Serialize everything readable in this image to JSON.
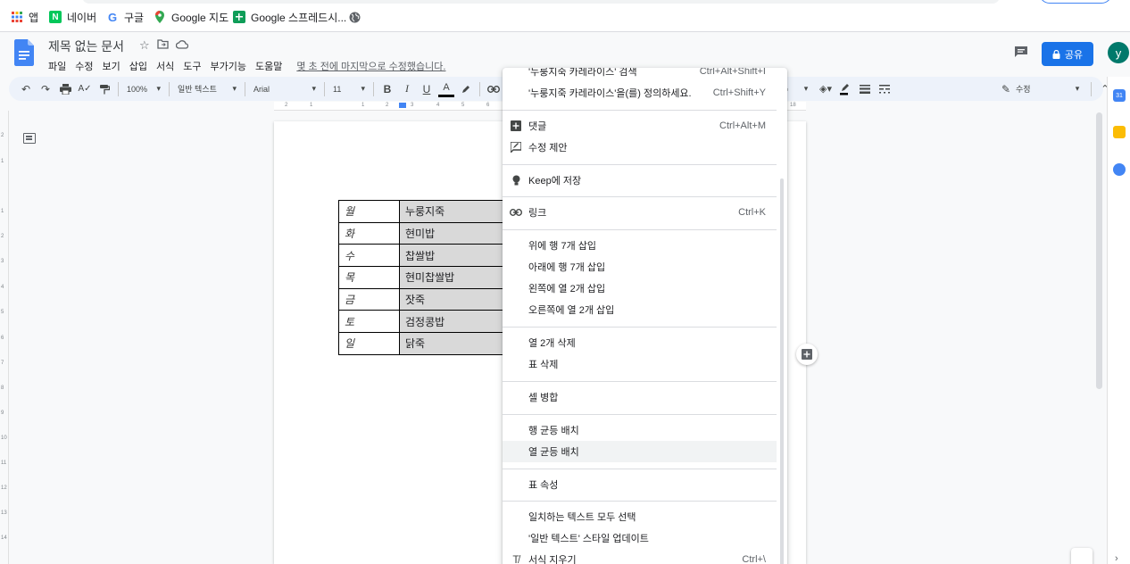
{
  "bookmarks": [
    {
      "label": "앱",
      "icon": "apps-grid-icon"
    },
    {
      "label": "네이버",
      "icon": "naver-icon"
    },
    {
      "label": "구글",
      "icon": "google-icon"
    },
    {
      "label": "Google 지도",
      "icon": "maps-icon"
    },
    {
      "label": "Google 스프레드시...",
      "icon": "sheets-icon"
    },
    {
      "label": "",
      "icon": "globe-icon"
    }
  ],
  "header": {
    "doc_title": "제목 없는 문서",
    "menus": [
      "파일",
      "수정",
      "보기",
      "삽입",
      "서식",
      "도구",
      "부가기능",
      "도움말"
    ],
    "last_edit": "몇 초 전에 마지막으로 수정했습니다.",
    "share_label": "공유",
    "avatar_letter": "y"
  },
  "toolbar": {
    "zoom": "100%",
    "style": "일반 텍스트",
    "font": "Arial",
    "font_size": "11",
    "bold": "B",
    "italic": "I",
    "underline": "U",
    "text_color": "A",
    "mode": "수정"
  },
  "ruler": [
    "2",
    "1",
    "1",
    "2",
    "3",
    "4",
    "5",
    "6",
    "18"
  ],
  "vruler": [
    "2",
    "1",
    "1",
    "2",
    "3",
    "4",
    "5",
    "6",
    "7",
    "8",
    "9",
    "10",
    "11",
    "12",
    "13",
    "14"
  ],
  "table": [
    {
      "day": "월",
      "food": "누룽지죽"
    },
    {
      "day": "화",
      "food": "현미밥"
    },
    {
      "day": "수",
      "food": "찹쌀밥"
    },
    {
      "day": "목",
      "food": "현미찹쌀밥"
    },
    {
      "day": "금",
      "food": "잣죽"
    },
    {
      "day": "토",
      "food": "검정콩밥"
    },
    {
      "day": "일",
      "food": "닭죽"
    }
  ],
  "context_menu": {
    "items": [
      {
        "label": "'누룽지죽 카레라이스' 검색",
        "shortcut": "Ctrl+Alt+Shift+I",
        "icon": ""
      },
      {
        "label": "'누룽지죽 카레라이스'을(를) 정의하세요.",
        "shortcut": "Ctrl+Shift+Y",
        "icon": ""
      },
      {
        "label": "댓글",
        "shortcut": "Ctrl+Alt+M",
        "icon": "add-comment-icon"
      },
      {
        "label": "수정 제안",
        "shortcut": "",
        "icon": "suggest-edit-icon"
      },
      {
        "label": "Keep에 저장",
        "shortcut": "",
        "icon": "keep-bulb-icon"
      },
      {
        "label": "링크",
        "shortcut": "Ctrl+K",
        "icon": "link-icon"
      },
      {
        "label": "위에 행 7개 삽입",
        "shortcut": "",
        "icon": ""
      },
      {
        "label": "아래에 행 7개 삽입",
        "shortcut": "",
        "icon": ""
      },
      {
        "label": "왼쪽에 열 2개 삽입",
        "shortcut": "",
        "icon": ""
      },
      {
        "label": "오른쪽에 열 2개 삽입",
        "shortcut": "",
        "icon": ""
      },
      {
        "label": "열 2개 삭제",
        "shortcut": "",
        "icon": ""
      },
      {
        "label": "표 삭제",
        "shortcut": "",
        "icon": ""
      },
      {
        "label": "셀 병합",
        "shortcut": "",
        "icon": ""
      },
      {
        "label": "행 균등 배치",
        "shortcut": "",
        "icon": ""
      },
      {
        "label": "열 균등 배치",
        "shortcut": "",
        "icon": ""
      },
      {
        "label": "표 속성",
        "shortcut": "",
        "icon": ""
      },
      {
        "label": "일치하는 텍스트 모두 선택",
        "shortcut": "",
        "icon": ""
      },
      {
        "label": "'일반 텍스트' 스타일 업데이트",
        "shortcut": "",
        "icon": ""
      },
      {
        "label": "서식 지우기",
        "shortcut": "Ctrl+\\",
        "icon": "clear-format-icon"
      }
    ],
    "highlighted_index": 14
  },
  "colors": {
    "accent": "#1a73e8",
    "avatar": "#00796b",
    "table_fill": "#d9d9d9"
  }
}
